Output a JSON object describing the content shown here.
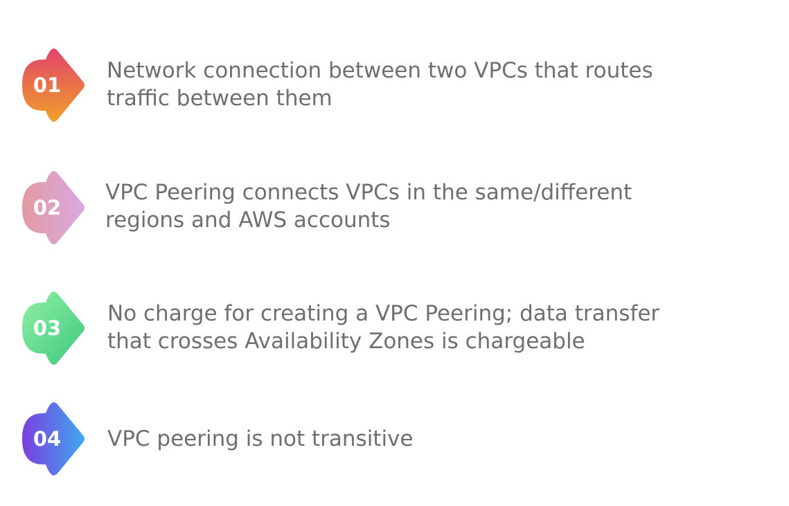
{
  "items": [
    {
      "number": "01",
      "line1": "Network connection between two VPCs that routes",
      "line2": "traffic between them",
      "gradient": [
        "#e0446a",
        "#f0a02a"
      ]
    },
    {
      "number": "02",
      "line1": "VPC Peering connects VPCs in the same/different",
      "line2": "regions and AWS accounts",
      "gradient": [
        "#e39aa2",
        "#d9a9df"
      ]
    },
    {
      "number": "03",
      "line1": "No charge for creating a VPC Peering; data transfer",
      "line2": "that crosses Availability Zones is chargeable",
      "gradient": [
        "#8ff0a4",
        "#3fc87f"
      ]
    },
    {
      "number": "04",
      "line1": "VPC peering is not transitive",
      "line2": "",
      "gradient": [
        "#7a3fe0",
        "#40a8f0"
      ]
    }
  ],
  "colors": {
    "text": "#6f6f6f",
    "badge_text": "#ffffff",
    "background": "#ffffff"
  }
}
